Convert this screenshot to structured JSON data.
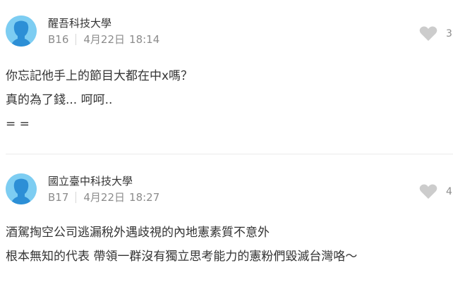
{
  "comments": [
    {
      "school": "醒吾科技大學",
      "floor": "B16",
      "date": "4月22日",
      "time": "18:14",
      "like_count": "3",
      "lines": [
        "你忘記他手上的節目大都在中x嗎？",
        "真的為了錢... 呵呵..",
        "= ="
      ]
    },
    {
      "school": "國立臺中科技大學",
      "floor": "B17",
      "date": "4月22日",
      "time": "18:27",
      "like_count": "4",
      "lines": [
        "酒駕掏空公司逃漏稅外遇歧視的內地憲素質不意外",
        "根本無知的代表 帶領一群沒有獨立思考能力的憲粉們毀滅台灣咯～"
      ]
    }
  ],
  "icons": {
    "avatar": "default-user-avatar-icon",
    "like": "heart-icon"
  },
  "colors": {
    "avatar_bg": "#7dcdf2",
    "avatar_figure": "#2c8fd6",
    "heart": "#cccccc",
    "meta_text": "#8c8c8c"
  }
}
